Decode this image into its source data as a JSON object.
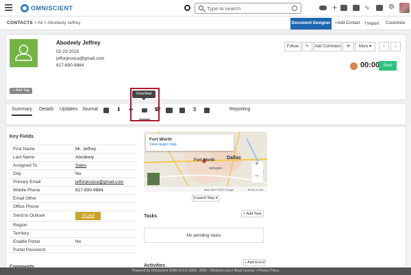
{
  "topbar": {
    "logo": "OMNISCIENT",
    "search_placeholder": "Type to search"
  },
  "breadcrumb": {
    "root": "CONTACTS",
    "sep1": ">",
    "all": "All",
    "sep2": ">",
    "current": "Abodeely Jeffrey"
  },
  "actions": {
    "document_designer": "Document Designer",
    "add_contact": "+Add Contact",
    "import": "⇡Import",
    "customize": "Customize"
  },
  "contact": {
    "name": "Abodeely Jeffrey",
    "date": "02-23-2015",
    "email": "jefforjessica@gmail.com",
    "phone": "817-690-9884",
    "add_tag": "+ Add Tag"
  },
  "card_buttons": {
    "follow": "Follow",
    "add_comment": "Add Comment",
    "more": "More"
  },
  "timer": {
    "time": "00:00",
    "start": "Start"
  },
  "tabs": [
    "Summary",
    "Details",
    "Updates",
    "Journal"
  ],
  "reporting": "Reporting",
  "tooltip": "OmniMail",
  "key_fields": {
    "title": "Key Fields",
    "rows": [
      {
        "k": "First Name",
        "v": "Mr. Jeffrey"
      },
      {
        "k": "Last Name",
        "v": "Abodeely"
      },
      {
        "k": "Assigned To",
        "v": "Sales"
      },
      {
        "k": "Drip",
        "v": "No"
      },
      {
        "k": "Primary Email",
        "v": "jefforjessica@gmail.com"
      },
      {
        "k": "Mobile Phone",
        "v": "817-690-9884"
      },
      {
        "k": "Email Other",
        "v": ""
      },
      {
        "k": "Office Phone",
        "v": ""
      },
      {
        "k": "Send to Outlook",
        "v": ""
      },
      {
        "k": "Region",
        "v": ""
      },
      {
        "k": "Territory",
        "v": ""
      },
      {
        "k": "Enable Portal",
        "v": "No"
      },
      {
        "k": "Portal Password",
        "v": ""
      }
    ],
    "vcard": "VCard"
  },
  "comments_title": "Comments",
  "map": {
    "city": "Fort Worth",
    "link": "View larger map",
    "dallas": "Dallas",
    "fortworth": "Fort Worth",
    "arlington": "Arlington",
    "attribution": "Map data ©2020 Google",
    "terms": "Terms of Use",
    "expand": "Expand Map"
  },
  "tasks": {
    "title": "Tasks",
    "add": "+ Add Task",
    "empty": "No pending tasks"
  },
  "activities": {
    "title": "Activities",
    "add": "+ Add Event"
  },
  "footer": "Powered by Omniscient CRM v4.0 © 2004 - 2020 · Omnicrm.com | Read License | Privacy Policy"
}
